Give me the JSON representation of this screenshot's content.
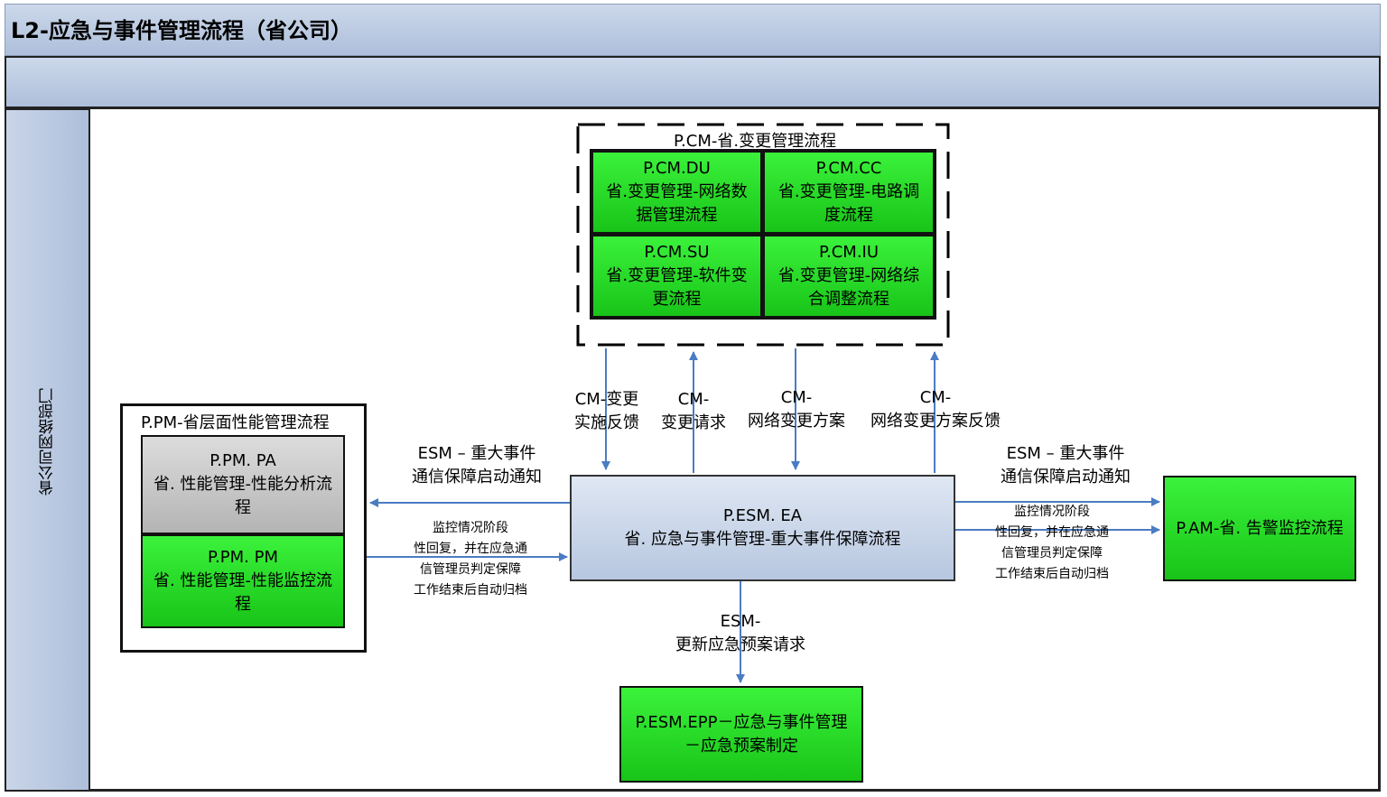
{
  "header": {
    "title": "L2-应急与事件管理流程（省公司）"
  },
  "lane": {
    "name": "省公司网络部门"
  },
  "cm_group": {
    "title": "P.CM-省.变更管理流程",
    "du": {
      "code": "P.CM.DU",
      "line1": "省.变更管理-网络数",
      "line2": "据管理流程"
    },
    "cc": {
      "code": "P.CM.CC",
      "line1": "省.变更管理-电路调",
      "line2": "度流程"
    },
    "su": {
      "code": "P.CM.SU",
      "line1": "省.变更管理-软件变",
      "line2": "更流程"
    },
    "iu": {
      "code": "P.CM.IU",
      "line1": "省.变更管理-网络综",
      "line2": "合调整流程"
    }
  },
  "pm_group": {
    "title": "P.PM-省层面性能管理流程",
    "pa": {
      "code": "P.PM. PA",
      "line1": "省. 性能管理-性能分析流",
      "line2": "程"
    },
    "pm": {
      "code": "P.PM. PM",
      "line1": "省. 性能管理-性能监控流",
      "line2": "程"
    }
  },
  "esm_ea": {
    "code": "P.ESM. EA",
    "line1": "省. 应急与事件管理-重大事件保障流程"
  },
  "am": {
    "label": "P.AM-省. 告警监控流程"
  },
  "epp": {
    "line1": "P.ESM.EPP－应急与事件管理",
    "line2": "－应急预案制定"
  },
  "flows": {
    "cm_feedback": {
      "line1": "CM-变更",
      "line2": "实施反馈"
    },
    "cm_request": {
      "line1": "CM-",
      "line2": "变更请求"
    },
    "cm_plan": {
      "line1": "CM-",
      "line2": "网络变更方案"
    },
    "cm_plan_feedback": {
      "line1": "CM-",
      "line2": "网络变更方案反馈"
    },
    "esm_notify_left": {
      "line1": "ESM – 重大事件",
      "line2": "通信保障启动通知"
    },
    "esm_notify_right": {
      "line1": "ESM – 重大事件",
      "line2": "通信保障启动通知"
    },
    "monitor_left": {
      "line1": "监控情况阶段",
      "line2": "性回复，并在应急通",
      "line3": "信管理员判定保障",
      "line4": "工作结束后自动归档"
    },
    "monitor_right": {
      "line1": "监控情况阶段",
      "line2": "性回复，并在应急通",
      "line3": "信管理员判定保障",
      "line4": "工作结束后自动归档"
    },
    "esm_update": {
      "line1": "ESM-",
      "line2": "更新应急预案请求"
    }
  },
  "colors": {
    "process_green": "#22d822",
    "arrow_blue": "#4a7cc2",
    "header_blue": "#b8c8e0"
  }
}
